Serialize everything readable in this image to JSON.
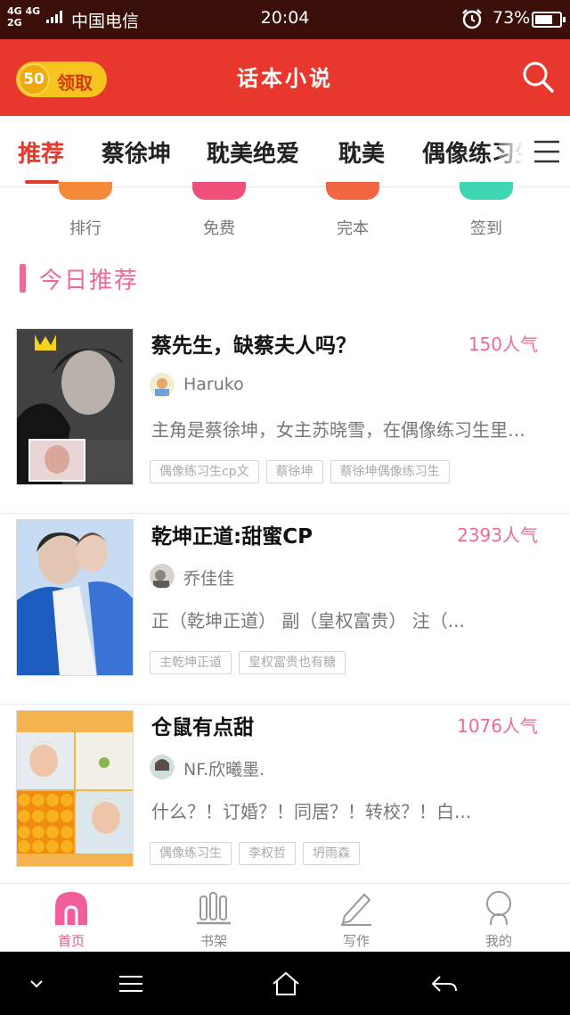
{
  "status_bar": {
    "network": "4G 4G",
    "network2": "2G",
    "carrier": "中国电信",
    "time": "20:04",
    "battery_pct": "73%",
    "battery_level": 0.73
  },
  "header": {
    "coin_amount": "50",
    "coin_label": "领取",
    "title": "话本小说"
  },
  "tabs": [
    "推荐",
    "蔡徐坤",
    "耽美绝爱",
    "耽美",
    "偶像练习生"
  ],
  "active_tab": 0,
  "categories": [
    {
      "label": "排行",
      "color": "#f5893a"
    },
    {
      "label": "免费",
      "color": "#f04f7a"
    },
    {
      "label": "完本",
      "color": "#f26541"
    },
    {
      "label": "签到",
      "color": "#3fd6b4"
    }
  ],
  "section": {
    "title": "今日推荐"
  },
  "books": [
    {
      "title": "蔡先生，缺蔡夫人吗？",
      "popularity": "150人气",
      "author": "Haruko",
      "summary": "主角是蔡徐坤，女主苏晓雪，在偶像练习生里面...",
      "tags": [
        "偶像练习生cp文",
        "蔡徐坤",
        "蔡徐坤偶像练习生"
      ]
    },
    {
      "title": "乾坤正道:甜蜜CP",
      "popularity": "2393人气",
      "author": "乔佳佳",
      "summary": "正（乾坤正道） 副（皇权富贵） 注（...",
      "tags": [
        "主乾坤正道",
        "皇权富贵也有糖"
      ]
    },
    {
      "title": "仓鼠有点甜",
      "popularity": "1076人气",
      "author": "NF.欣曦墨.",
      "summary": "什么？！订婚？！同居？！转校？！白...",
      "tags": [
        "偶像练习生",
        "李权哲",
        "坍雨森"
      ]
    }
  ],
  "bottom_nav": [
    {
      "label": "首页",
      "icon": "home-icon"
    },
    {
      "label": "书架",
      "icon": "bookshelf-icon"
    },
    {
      "label": "写作",
      "icon": "pen-icon"
    },
    {
      "label": "我的",
      "icon": "profile-icon"
    }
  ],
  "colors": {
    "brand_red": "#e8382d",
    "accent_pink": "#ef6a9a",
    "coin_yellow": "#f7c31e"
  }
}
